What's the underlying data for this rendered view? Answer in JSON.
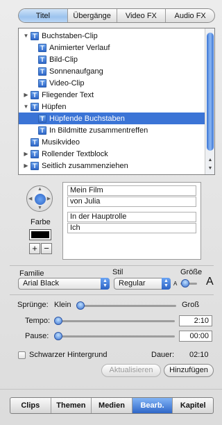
{
  "tabs": [
    {
      "label": "Titel",
      "active": true
    },
    {
      "label": "Übergänge",
      "active": false
    },
    {
      "label": "Video FX",
      "active": false
    },
    {
      "label": "Audio FX",
      "active": false
    }
  ],
  "title_list": [
    {
      "label": "Buchstaben-Clip",
      "level": 0,
      "expanded": true,
      "selected": false
    },
    {
      "label": "Animierter Verlauf",
      "level": 1,
      "selected": false
    },
    {
      "label": "Bild-Clip",
      "level": 1,
      "selected": false
    },
    {
      "label": "Sonnenaufgang",
      "level": 1,
      "selected": false
    },
    {
      "label": "Video-Clip",
      "level": 1,
      "selected": false
    },
    {
      "label": "Fliegender Text",
      "level": 0,
      "expanded": false,
      "selected": false
    },
    {
      "label": "Hüpfen",
      "level": 0,
      "expanded": true,
      "selected": false
    },
    {
      "label": "Hüpfende Buchstaben",
      "level": 1,
      "selected": true
    },
    {
      "label": "In Bildmitte zusammentreffen",
      "level": 1,
      "selected": false
    },
    {
      "label": "Musikvideo",
      "level": 0,
      "leaf": true,
      "selected": false
    },
    {
      "label": "Rollender Textblock",
      "level": 0,
      "expanded": false,
      "selected": false
    },
    {
      "label": "Seitlich zusammenziehen",
      "level": 0,
      "expanded": false,
      "selected": false
    }
  ],
  "editor": {
    "farbe_label": "Farbe",
    "plus_label": "+",
    "minus_label": "−",
    "text_fields": [
      "Mein Film",
      "von Julia",
      "In der Hauptrolle",
      "Ich"
    ]
  },
  "font": {
    "familie_label": "Familie",
    "familie_value": "Arial Black",
    "stil_label": "Stil",
    "stil_value": "Regular",
    "groesse_label": "Größe",
    "small_a": "A",
    "large_a": "A",
    "size_level": 0.2
  },
  "controls": {
    "spruenge_label": "Sprünge:",
    "klein_label": "Klein",
    "gross_label": "Groß",
    "spruenge_level": 0.0,
    "tempo_label": "Tempo:",
    "tempo_value": "2:10",
    "tempo_level": 0.0,
    "pause_label": "Pause:",
    "pause_value": "00:00",
    "pause_level": 0.0,
    "background_checkbox_label": "Schwarzer Hintergrund",
    "background_checked": false,
    "dauer_label": "Dauer:",
    "dauer_value": "02:10"
  },
  "buttons": {
    "update_label": "Aktualisieren",
    "add_label": "Hinzufügen"
  },
  "nav": [
    {
      "label": "Clips",
      "active": false
    },
    {
      "label": "Themen",
      "active": false
    },
    {
      "label": "Medien",
      "active": false
    },
    {
      "label": "Bearb.",
      "active": true
    },
    {
      "label": "Kapitel",
      "active": false
    }
  ],
  "colors": {
    "selection": "#3b74d6",
    "accent_blue": "#2f67c8"
  }
}
